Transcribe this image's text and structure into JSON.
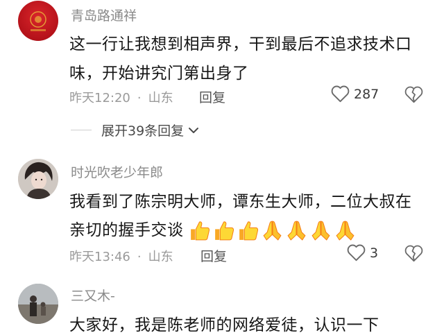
{
  "comments": [
    {
      "username": "青岛路通祥",
      "lines": [
        "这一行让我想到相声界，干到最后不追求技术口",
        "味，开始讲究门第出身了"
      ],
      "time": "昨天12:20",
      "location": "山东",
      "reply_label": "回复",
      "likes": "287",
      "expand_label": "展开39条回复",
      "avatar_color": "#c7151b"
    },
    {
      "username": "时光吹老少年郎",
      "lines": [
        "我看到了陈宗明大师，谭东生大师，二位大叔在",
        "亲切的握手交谈"
      ],
      "emojis": [
        "thumbs-up",
        "thumbs-up",
        "thumbs-up",
        "pray",
        "pray",
        "pray",
        "pray"
      ],
      "time": "昨天13:46",
      "location": "山东",
      "reply_label": "回复",
      "likes": "3"
    },
    {
      "username": "三又木-",
      "lines": [
        "大家好，我是陈老师的网络爱徒，认识一下"
      ]
    }
  ],
  "separator_dot": "·",
  "colors": {
    "username": "#8a8a8a",
    "meta": "#9a9a9a",
    "text": "#161616",
    "emoji_yellow": "#fbc02d"
  }
}
